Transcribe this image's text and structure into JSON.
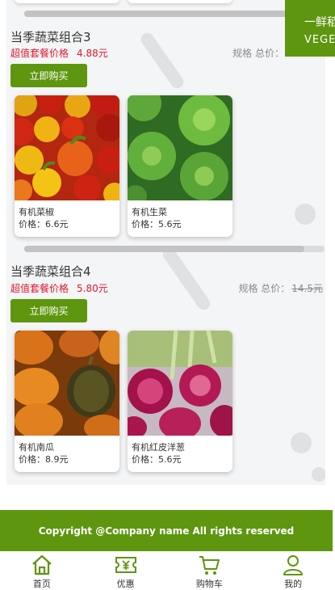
{
  "banner": {
    "line1": "一鲜稻",
    "line2": "VEGETABLE"
  },
  "groups": [
    {
      "title": "当季蔬菜组合3",
      "promo_label": "超值套餐价格",
      "promo_price": "4.88元",
      "total_label": "规格 总价：",
      "old_price": "",
      "buy_label": "立即购买",
      "items": [
        {
          "name": "有机菜椒",
          "price": "价格：6.6元",
          "image": "bell-peppers"
        },
        {
          "name": "有机生菜",
          "price": "价格：5.6元",
          "image": "lettuce"
        }
      ]
    },
    {
      "title": "当季蔬菜组合4",
      "promo_label": "超值套餐价格",
      "promo_price": "5.80元",
      "total_label": "规格 总价：",
      "old_price": "14.5元",
      "buy_label": "立即购买",
      "items": [
        {
          "name": "有机南瓜",
          "price": "价格：8.9元",
          "image": "pumpkins"
        },
        {
          "name": "有机红皮洋葱",
          "price": "价格：5.6元",
          "image": "red-onions"
        }
      ]
    }
  ],
  "footer": {
    "copyright": "Copyright @Company name All rights reserved"
  },
  "tabbar": {
    "items": [
      {
        "label": "首页",
        "icon": "home-icon"
      },
      {
        "label": "优惠",
        "icon": "coupon-icon"
      },
      {
        "label": "购物车",
        "icon": "cart-icon"
      },
      {
        "label": "我的",
        "icon": "user-icon"
      }
    ]
  },
  "colors": {
    "accent": "#5e960f",
    "promo": "#e0182e",
    "muted": "#8a8a8a"
  }
}
